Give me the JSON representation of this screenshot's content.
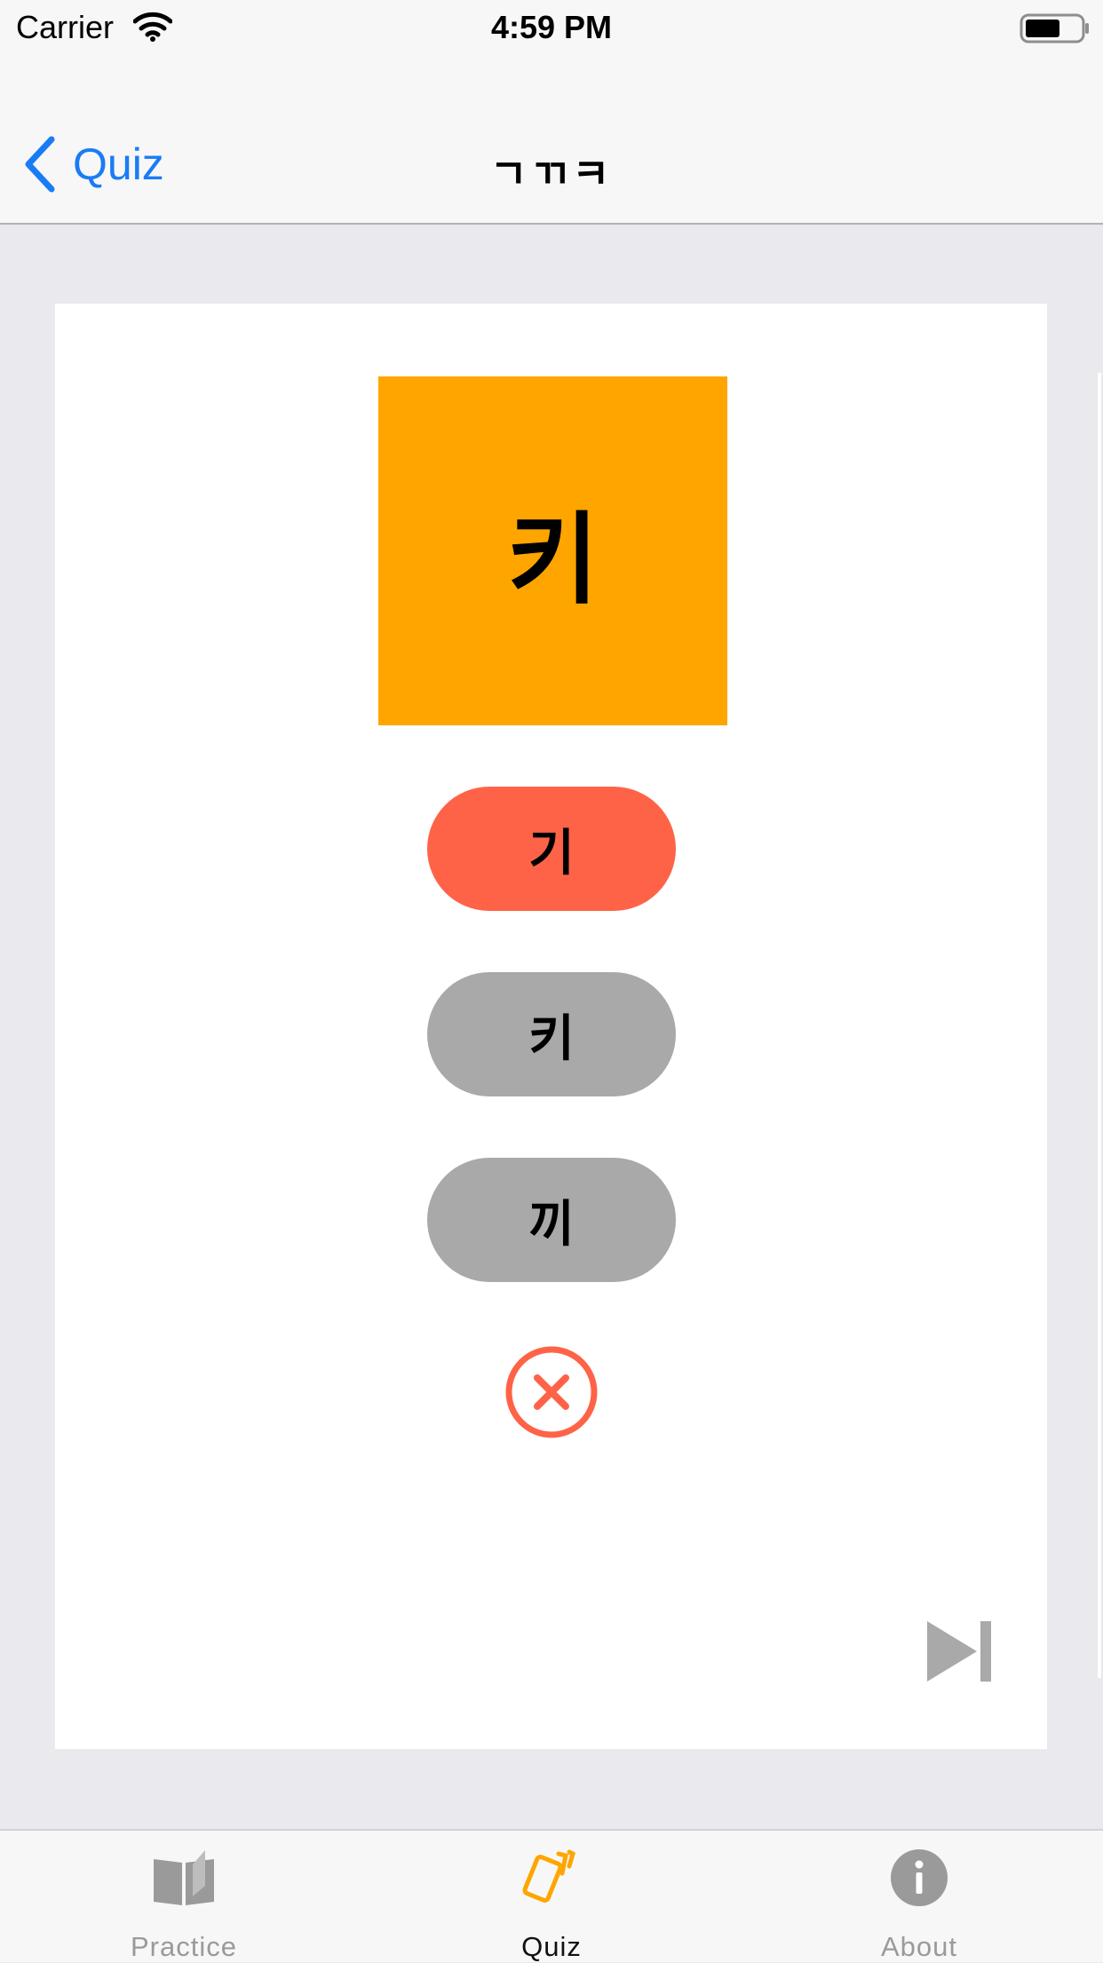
{
  "status_bar": {
    "carrier": "Carrier",
    "time": "4:59 PM"
  },
  "nav": {
    "back_label": "Quiz",
    "title": "ㄱㄲㅋ"
  },
  "quiz": {
    "prompt_letter": "키",
    "prompt_color": "#ffa500",
    "choices": [
      {
        "label": "기",
        "state": "wrong",
        "color": "#ff6347"
      },
      {
        "label": "키",
        "state": "neutral",
        "color": "#a9a9a9"
      },
      {
        "label": "끼",
        "state": "neutral",
        "color": "#a9a9a9"
      }
    ],
    "result_icon": "x-circle-icon",
    "result_color": "#ff6347"
  },
  "tabs": [
    {
      "label": "Practice",
      "icon": "book-icon",
      "active": false
    },
    {
      "label": "Quiz",
      "icon": "cards-icon",
      "active": true
    },
    {
      "label": "About",
      "icon": "info-icon",
      "active": false
    }
  ],
  "colors": {
    "accent": "#1a7cf5",
    "tab_active": "#ffa500",
    "tab_inactive": "#9a9a9a"
  }
}
